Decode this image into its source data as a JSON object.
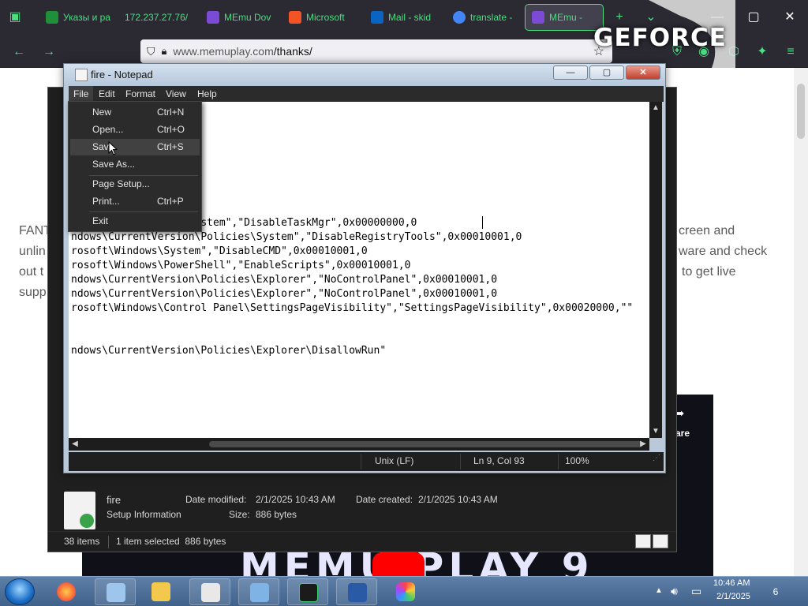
{
  "browser": {
    "tabs": [
      {
        "label": "Указы и ра",
        "color": "#1f8f3a"
      },
      {
        "label": "172.237.27.76/",
        "color": "#1f8f3a"
      },
      {
        "label": "MEmu Dov",
        "color": "#7b4bd6"
      },
      {
        "label": "Microsoft",
        "color": "#f35325"
      },
      {
        "label": "Mail - skid",
        "color": "#0a64c2"
      },
      {
        "label": "translate -",
        "color": "#4285f4"
      },
      {
        "label": "MEmu -",
        "color": "#7b4bd6"
      }
    ],
    "url_host": "www.memuplay.com",
    "url_path": "/thanks/"
  },
  "overlay": {
    "geforce": "GEFORCE"
  },
  "page": {
    "lines": [
      {
        "left": "FANT",
        "right": "creen and"
      },
      {
        "left": "unlin",
        "right": "ware and check"
      },
      {
        "left": "out t",
        "right": "to get live"
      },
      {
        "left": "supp",
        "right": ""
      }
    ],
    "video_share": "are",
    "video_banner": "MEMU PLAY 9"
  },
  "notepad": {
    "title": "fire - Notepad",
    "menu": [
      "File",
      "Edit",
      "Format",
      "View",
      "Help"
    ],
    "lines": [
      "          Policies\\System\",\"DisableTaskMgr\",0x00000000,0",
      "ndows\\CurrentVersion\\Policies\\System\",\"DisableRegistryTools\",0x00010001,0",
      "rosoft\\Windows\\System\",\"DisableCMD\",0x00010001,0",
      "rosoft\\Windows\\PowerShell\",\"EnableScripts\",0x00010001,0",
      "ndows\\CurrentVersion\\Policies\\Explorer\",\"NoControlPanel\",0x00010001,0",
      "ndows\\CurrentVersion\\Policies\\Explorer\",\"NoControlPanel\",0x00010001,0",
      "rosoft\\Windows\\Control Panel\\SettingsPageVisibility\",\"SettingsPageVisibility\",0x00020000,\"\"",
      "",
      "",
      "ndows\\CurrentVersion\\Policies\\Explorer\\DisallowRun\""
    ],
    "status": {
      "encoding": "Unix (LF)",
      "position": "Ln 9, Col 93",
      "zoom": "100%"
    },
    "file_menu": [
      {
        "label": "New",
        "shortcut": "Ctrl+N"
      },
      {
        "label": "Open...",
        "shortcut": "Ctrl+O"
      },
      {
        "label": "Save",
        "shortcut": "Ctrl+S"
      },
      {
        "label": "Save As...",
        "shortcut": ""
      },
      {
        "label": "Page Setup...",
        "shortcut": ""
      },
      {
        "label": "Print...",
        "shortcut": "Ctrl+P"
      },
      {
        "label": "Exit",
        "shortcut": ""
      }
    ]
  },
  "explorer": {
    "file_name": "fire",
    "file_type": "Setup Information",
    "date_modified_label": "Date modified:",
    "date_modified": "2/1/2025 10:43 AM",
    "date_created_label": "Date created:",
    "date_created": "2/1/2025 10:43 AM",
    "size_label": "Size:",
    "size": "886 bytes",
    "status_items": "38 items",
    "status_selected": "1 item selected  886 bytes"
  },
  "taskbar": {
    "time": "10:46 AM",
    "date": "2/1/2025",
    "notifications": "6"
  }
}
